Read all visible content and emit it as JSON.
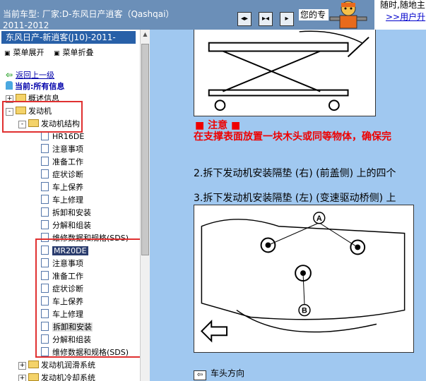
{
  "header": {
    "title": "当前车型:   厂家:D-东风日产逍客（Qashqai）",
    "year": "2011-2012",
    "nav_buttons": [
      "◂▸",
      "▸◂",
      "▸"
    ],
    "truncated_text": "您的专",
    "promo_line1": "随时,随地主",
    "promo_line2": ">>用户升"
  },
  "sidebar": {
    "car_bar": "东风日产-新逍客(J10)-2011-",
    "tools": [
      "菜单展开",
      "菜单折叠"
    ],
    "back_label": "返回上一级",
    "current_label": "当前:所有信息",
    "tree": [
      {
        "label": "概述信息",
        "type": "folder",
        "level": 0,
        "expander": "+"
      },
      {
        "label": "发动机",
        "type": "folder",
        "level": 0,
        "expander": "-"
      },
      {
        "label": "发动机结构",
        "type": "folder",
        "level": 1,
        "expander": "-"
      },
      {
        "label": "HR16DE",
        "type": "doc",
        "level": 2
      },
      {
        "label": "注意事项",
        "type": "doc",
        "level": 2
      },
      {
        "label": "准备工作",
        "type": "doc",
        "level": 2
      },
      {
        "label": "症状诊断",
        "type": "doc",
        "level": 2
      },
      {
        "label": "车上保养",
        "type": "doc",
        "level": 2
      },
      {
        "label": "车上修理",
        "type": "doc",
        "level": 2
      },
      {
        "label": "拆卸和安装",
        "type": "doc",
        "level": 2
      },
      {
        "label": "分解和组装",
        "type": "doc",
        "level": 2
      },
      {
        "label": "维修数据和规格(SDS)",
        "type": "doc",
        "level": 2
      },
      {
        "label": "MR20DE",
        "type": "doc",
        "level": 2,
        "selected": true
      },
      {
        "label": "注意事项",
        "type": "doc",
        "level": 2
      },
      {
        "label": "准备工作",
        "type": "doc",
        "level": 2
      },
      {
        "label": "症状诊断",
        "type": "doc",
        "level": 2
      },
      {
        "label": "车上保养",
        "type": "doc",
        "level": 2
      },
      {
        "label": "车上修理",
        "type": "doc",
        "level": 2
      },
      {
        "label": "拆卸和安装",
        "type": "doc",
        "level": 2,
        "highlighted": true
      },
      {
        "label": "分解和组装",
        "type": "doc",
        "level": 2
      },
      {
        "label": "维修数据和规格(SDS)",
        "type": "doc",
        "level": 2
      },
      {
        "label": "发动机润滑系统",
        "type": "folder",
        "level": 1,
        "expander": "+"
      },
      {
        "label": "发动机冷却系统",
        "type": "folder",
        "level": 1,
        "expander": "+"
      }
    ]
  },
  "content": {
    "note_title": "■ 注意 ■",
    "note_text": "在支撑表面放置一块木头或同等物体，确保完",
    "step2": "2.拆下发动机安装隔垫 (右) (前盖侧) 上的四个",
    "step3": "3.拆下发动机安装隔垫 (左) (变速驱动桥侧) 上",
    "callout_a": "A",
    "callout_b": "B",
    "legend_text": "车头方向",
    "legend_icon": "arrow-left-icon"
  }
}
